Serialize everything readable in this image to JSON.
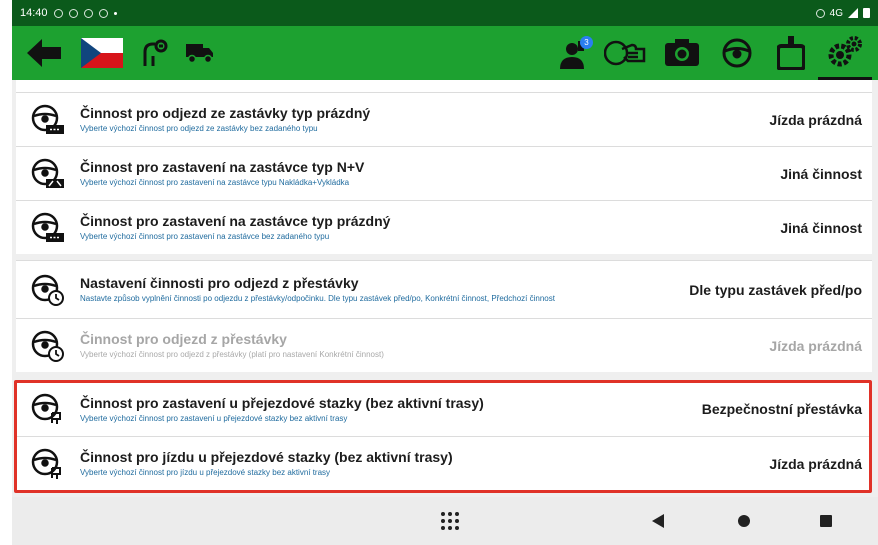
{
  "status_bar": {
    "time": "14:40",
    "network": "4G"
  },
  "toolbar": {
    "items": [
      {
        "name": "back-arrow-icon"
      },
      {
        "name": "czech-flag-icon",
        "colors": [
          "#ffffff",
          "#d7141a",
          "#11457e"
        ]
      },
      {
        "name": "route-icon"
      },
      {
        "name": "truck-icon"
      },
      {
        "name": "driver-icon",
        "badge": "3"
      },
      {
        "name": "handshake-icon"
      },
      {
        "name": "camera-icon"
      },
      {
        "name": "steering-wheel-icon"
      },
      {
        "name": "tachograph-icon"
      },
      {
        "name": "settings-gears-icon",
        "active": true
      }
    ]
  },
  "settings": {
    "groups": [
      {
        "rows": [
          {
            "icon": "steering-wheel-empty-icon",
            "title": "Činnost pro odjezd ze zastávky typ prázdný",
            "subtitle": "Vyberte výchozí činnost pro odjezd ze zastávky bez zadaného typu",
            "value": "Jízda prázdná",
            "disabled": false
          },
          {
            "icon": "steering-wheel-load-icon",
            "title": "Činnost pro zastavení na zastávce typ N+V",
            "subtitle": "Vyberte výchozí činnost pro zastavení na zastávce typu Nakládka+Vykládka",
            "value": "Jiná činnost",
            "disabled": false
          },
          {
            "icon": "steering-wheel-empty-icon",
            "title": "Činnost pro zastavení na zastávce typ prázdný",
            "subtitle": "Vyberte výchozí činnost pro zastavení na zastávce bez zadaného typu",
            "value": "Jiná činnost",
            "disabled": false
          }
        ]
      },
      {
        "rows": [
          {
            "icon": "steering-wheel-clock-icon",
            "title": "Nastavení činnosti pro odjezd z přestávky",
            "subtitle": "Nastavte způsob vyplnění činnosti po odjezdu z přestávky/odpočinku. Dle typu zastávek před/po, Konkrétní činnost, Předchozí činnost",
            "value": "Dle typu zastávek před/po",
            "disabled": false
          },
          {
            "icon": "steering-wheel-clock-icon",
            "title": "Činnost pro odjezd z přestávky",
            "subtitle": "Vyberte výchozí činnost pro odjezd z přestávky (platí pro nastavení Konkrétní činnost)",
            "value": "Jízda prázdná",
            "disabled": true
          }
        ]
      },
      {
        "rows": [
          {
            "icon": "steering-wheel-pin-icon",
            "title": "Činnost pro zastavení u přejezdové stazky (bez aktivní trasy)",
            "subtitle": "Vyberte výchozí činnost pro zastavení u přejezdové stazky bez aktivní trasy",
            "value": "Bezpečnostní přestávka",
            "disabled": false
          },
          {
            "icon": "steering-wheel-pin-icon",
            "title": "Činnost pro jízdu u přejezdové stazky (bez aktivní trasy)",
            "subtitle": "Vyberte výchozí činnost pro jízdu u přejezdové stazky bez aktivní trasy",
            "value": "Jízda prázdná",
            "disabled": false
          }
        ]
      }
    ]
  },
  "colors": {
    "toolbar": "#1da130",
    "status_bar": "#0b5a1b",
    "highlight": "#e03228",
    "subtitle": "#1f6b9e"
  }
}
